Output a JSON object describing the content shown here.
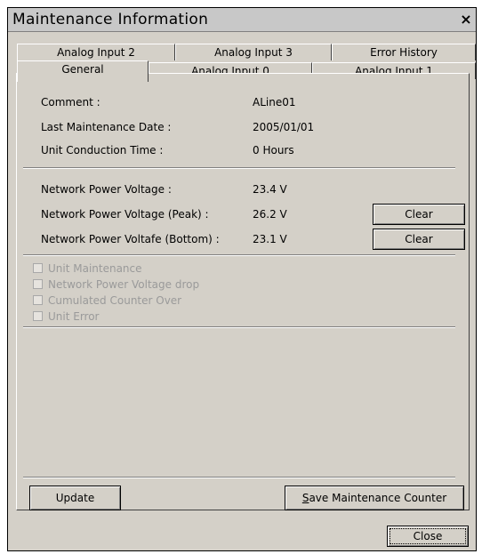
{
  "window": {
    "title": "Maintenance Information",
    "close_symbol": "×"
  },
  "tabs": {
    "row1": [
      "Analog Input 2",
      "Analog Input 3",
      "Error History"
    ],
    "row2": [
      "General",
      "Analog Input 0",
      "Analog Input 1"
    ],
    "active": "General"
  },
  "general": {
    "info": [
      {
        "label": "Comment :",
        "value": "ALine01"
      },
      {
        "label": "Last Maintenance Date :",
        "value": "2005/01/01"
      },
      {
        "label": "Unit Conduction Time :",
        "value": "0 Hours"
      }
    ],
    "voltage": [
      {
        "label": "Network Power Voltage :",
        "value": "23.4 V"
      },
      {
        "label": "Network Power Voltage (Peak) :",
        "value": "26.2 V",
        "button": "Clear"
      },
      {
        "label": "Network Power Voltafe (Bottom) :",
        "value": "23.1 V",
        "button": "Clear"
      }
    ],
    "checkboxes": [
      {
        "label": "Unit Maintenance",
        "checked": false,
        "enabled": false
      },
      {
        "label": "Network Power Voltage drop",
        "checked": false,
        "enabled": false
      },
      {
        "label": "Cumulated Counter Over",
        "checked": false,
        "enabled": false
      },
      {
        "label": "Unit Error",
        "checked": false,
        "enabled": false
      }
    ]
  },
  "buttons": {
    "update": "Update",
    "save_counter": "Save Maintenance Counter",
    "close": "Close"
  },
  "colors": {
    "dialog_bg": "#d4d0c8",
    "titlebar_bg": "#c8c8c8",
    "disabled_text": "#9a9a9a"
  }
}
